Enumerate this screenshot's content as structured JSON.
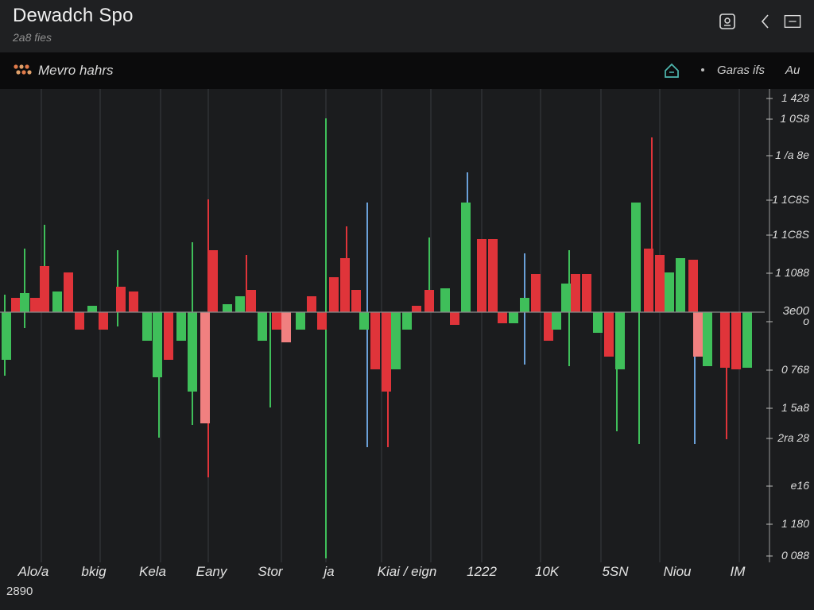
{
  "window": {
    "title": "Dewadch Spo",
    "subtitle": "2a8 fies"
  },
  "toolbar": {
    "label": "Mevro hahrs",
    "right_text_1": "Garas ifs",
    "right_text_2": "Au",
    "icons": [
      "chart-logo-icon",
      "home-icon",
      "image-icon",
      "back-icon",
      "panel-icon"
    ]
  },
  "footer": {
    "value": "2890"
  },
  "colors": {
    "up": "#3fbf5a",
    "down": "#e0343a",
    "down_light": "#f08080",
    "wick_blue": "#6aa0d8",
    "grid": "#3a3c40",
    "zero_line": "#8a8a8a",
    "background": "#1b1c1e"
  },
  "chart_data": {
    "type": "bar",
    "title": "",
    "xlabel": "",
    "ylabel": "",
    "ylim": [
      -300,
      280
    ],
    "y_tick_labels": [
      "1 428",
      "1 0S8",
      "1 /a 8e",
      "1 1C8S",
      "1 1C8S",
      "1 1088",
      "o",
      "0 768",
      "1 5a8",
      "2ra 28",
      "e16",
      "1 180",
      "0 088"
    ],
    "zero_label": "3e00",
    "x_tick_labels": [
      "Alo/a",
      "bkig",
      "Kela",
      "Eany",
      "Stor",
      "ja",
      "Kiai / eign",
      "1222",
      "10K",
      "5SN",
      "Niou",
      "IM"
    ],
    "bars": [
      {
        "x": 8,
        "v": -60,
        "c": "up"
      },
      {
        "x": 20,
        "v": 18,
        "c": "down"
      },
      {
        "x": 31,
        "v": 24,
        "c": "up"
      },
      {
        "x": 44,
        "v": 18,
        "c": "down"
      },
      {
        "x": 56,
        "v": 58,
        "c": "down"
      },
      {
        "x": 72,
        "v": 26,
        "c": "up"
      },
      {
        "x": 86,
        "v": 50,
        "c": "down"
      },
      {
        "x": 100,
        "v": -22,
        "c": "down"
      },
      {
        "x": 116,
        "v": 8,
        "c": "up"
      },
      {
        "x": 130,
        "v": -22,
        "c": "down"
      },
      {
        "x": 152,
        "v": 32,
        "c": "down"
      },
      {
        "x": 168,
        "v": 26,
        "c": "down"
      },
      {
        "x": 185,
        "v": -36,
        "c": "up"
      },
      {
        "x": 198,
        "v": -82,
        "c": "up"
      },
      {
        "x": 212,
        "v": -60,
        "c": "down"
      },
      {
        "x": 228,
        "v": -36,
        "c": "up"
      },
      {
        "x": 242,
        "v": -100,
        "c": "up"
      },
      {
        "x": 258,
        "v": -140,
        "c": "down_light"
      },
      {
        "x": 268,
        "v": 78,
        "c": "down"
      },
      {
        "x": 286,
        "v": 10,
        "c": "up"
      },
      {
        "x": 302,
        "v": 20,
        "c": "up"
      },
      {
        "x": 316,
        "v": 28,
        "c": "down"
      },
      {
        "x": 330,
        "v": -36,
        "c": "up"
      },
      {
        "x": 348,
        "v": -22,
        "c": "down"
      },
      {
        "x": 360,
        "v": -38,
        "c": "down_light"
      },
      {
        "x": 378,
        "v": -22,
        "c": "up"
      },
      {
        "x": 392,
        "v": 20,
        "c": "down"
      },
      {
        "x": 405,
        "v": -22,
        "c": "down"
      },
      {
        "x": 420,
        "v": 44,
        "c": "down"
      },
      {
        "x": 434,
        "v": 68,
        "c": "down"
      },
      {
        "x": 448,
        "v": 28,
        "c": "down"
      },
      {
        "x": 458,
        "v": -22,
        "c": "up"
      },
      {
        "x": 472,
        "v": -72,
        "c": "down"
      },
      {
        "x": 486,
        "v": -100,
        "c": "down"
      },
      {
        "x": 498,
        "v": -72,
        "c": "up"
      },
      {
        "x": 512,
        "v": -22,
        "c": "up"
      },
      {
        "x": 524,
        "v": 8,
        "c": "down"
      },
      {
        "x": 540,
        "v": 28,
        "c": "down"
      },
      {
        "x": 560,
        "v": 30,
        "c": "up"
      },
      {
        "x": 572,
        "v": -16,
        "c": "down"
      },
      {
        "x": 586,
        "v": 138,
        "c": "up"
      },
      {
        "x": 606,
        "v": 92,
        "c": "down"
      },
      {
        "x": 620,
        "v": 92,
        "c": "down"
      },
      {
        "x": 632,
        "v": -14,
        "c": "down"
      },
      {
        "x": 646,
        "v": -14,
        "c": "up"
      },
      {
        "x": 660,
        "v": 18,
        "c": "up"
      },
      {
        "x": 674,
        "v": 48,
        "c": "down"
      },
      {
        "x": 690,
        "v": -36,
        "c": "down"
      },
      {
        "x": 700,
        "v": -22,
        "c": "up"
      },
      {
        "x": 712,
        "v": 36,
        "c": "up"
      },
      {
        "x": 724,
        "v": 48,
        "c": "down"
      },
      {
        "x": 738,
        "v": 48,
        "c": "down"
      },
      {
        "x": 752,
        "v": -26,
        "c": "up"
      },
      {
        "x": 766,
        "v": -56,
        "c": "down"
      },
      {
        "x": 780,
        "v": -72,
        "c": "up"
      },
      {
        "x": 800,
        "v": 138,
        "c": "up"
      },
      {
        "x": 816,
        "v": 80,
        "c": "down"
      },
      {
        "x": 830,
        "v": 72,
        "c": "down"
      },
      {
        "x": 842,
        "v": 50,
        "c": "up"
      },
      {
        "x": 856,
        "v": 68,
        "c": "up"
      },
      {
        "x": 872,
        "v": 66,
        "c": "down"
      },
      {
        "x": 878,
        "v": -56,
        "c": "down_light"
      },
      {
        "x": 890,
        "v": -68,
        "c": "up"
      },
      {
        "x": 912,
        "v": -70,
        "c": "down"
      },
      {
        "x": 926,
        "v": -72,
        "c": "down"
      },
      {
        "x": 940,
        "v": -70,
        "c": "up"
      }
    ],
    "wicks": [
      {
        "x": 6,
        "hi": 22,
        "lo": -80,
        "c": "up"
      },
      {
        "x": 31,
        "hi": 80,
        "lo": -20,
        "c": "up"
      },
      {
        "x": 56,
        "hi": 110,
        "lo": 0,
        "c": "up"
      },
      {
        "x": 148,
        "hi": 78,
        "lo": -18,
        "c": "up"
      },
      {
        "x": 200,
        "hi": 0,
        "lo": -158,
        "c": "up"
      },
      {
        "x": 242,
        "hi": 88,
        "lo": -142,
        "c": "up"
      },
      {
        "x": 262,
        "hi": 142,
        "lo": -208,
        "c": "down"
      },
      {
        "x": 310,
        "hi": 72,
        "lo": 0,
        "c": "down"
      },
      {
        "x": 340,
        "hi": 0,
        "lo": -120,
        "c": "up"
      },
      {
        "x": 410,
        "hi": 244,
        "lo": -310,
        "c": "up"
      },
      {
        "x": 436,
        "hi": 108,
        "lo": 0,
        "c": "down"
      },
      {
        "x": 462,
        "hi": 138,
        "lo": -170,
        "c": "wick_blue"
      },
      {
        "x": 488,
        "hi": 0,
        "lo": -170,
        "c": "down"
      },
      {
        "x": 540,
        "hi": 94,
        "lo": 0,
        "c": "up"
      },
      {
        "x": 588,
        "hi": 176,
        "lo": 0,
        "c": "wick_blue"
      },
      {
        "x": 660,
        "hi": 74,
        "lo": -66,
        "c": "wick_blue"
      },
      {
        "x": 716,
        "hi": 78,
        "lo": -68,
        "c": "up"
      },
      {
        "x": 776,
        "hi": 0,
        "lo": -150,
        "c": "up"
      },
      {
        "x": 804,
        "hi": 90,
        "lo": -166,
        "c": "up"
      },
      {
        "x": 820,
        "hi": 220,
        "lo": 0,
        "c": "down"
      },
      {
        "x": 874,
        "hi": 0,
        "lo": -166,
        "c": "wick_blue"
      },
      {
        "x": 914,
        "hi": 0,
        "lo": -160,
        "c": "down"
      }
    ]
  }
}
